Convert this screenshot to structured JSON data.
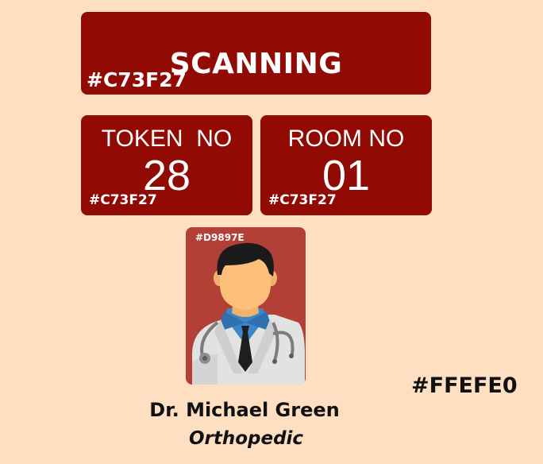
{
  "status": {
    "label": "SCANNING",
    "color_note": "#C73F27"
  },
  "token": {
    "label": "TOKEN  NO",
    "value": "28",
    "color_note": "#C73F27"
  },
  "room": {
    "label": "ROOM NO",
    "value": "01",
    "color_note": "#C73F27"
  },
  "doctor": {
    "card_color_note": "#D9897E",
    "name": "Dr. Michael Green",
    "specialty": "Orthopedic",
    "avatar_icon": "doctor-avatar-icon"
  },
  "background_color_note": "#FFEFE0",
  "colors": {
    "page_background": "#FFDFC1",
    "panel": "#910B04",
    "avatar_card": "#B24037",
    "text_dark": "#111111",
    "text_light": "#ffffff"
  }
}
